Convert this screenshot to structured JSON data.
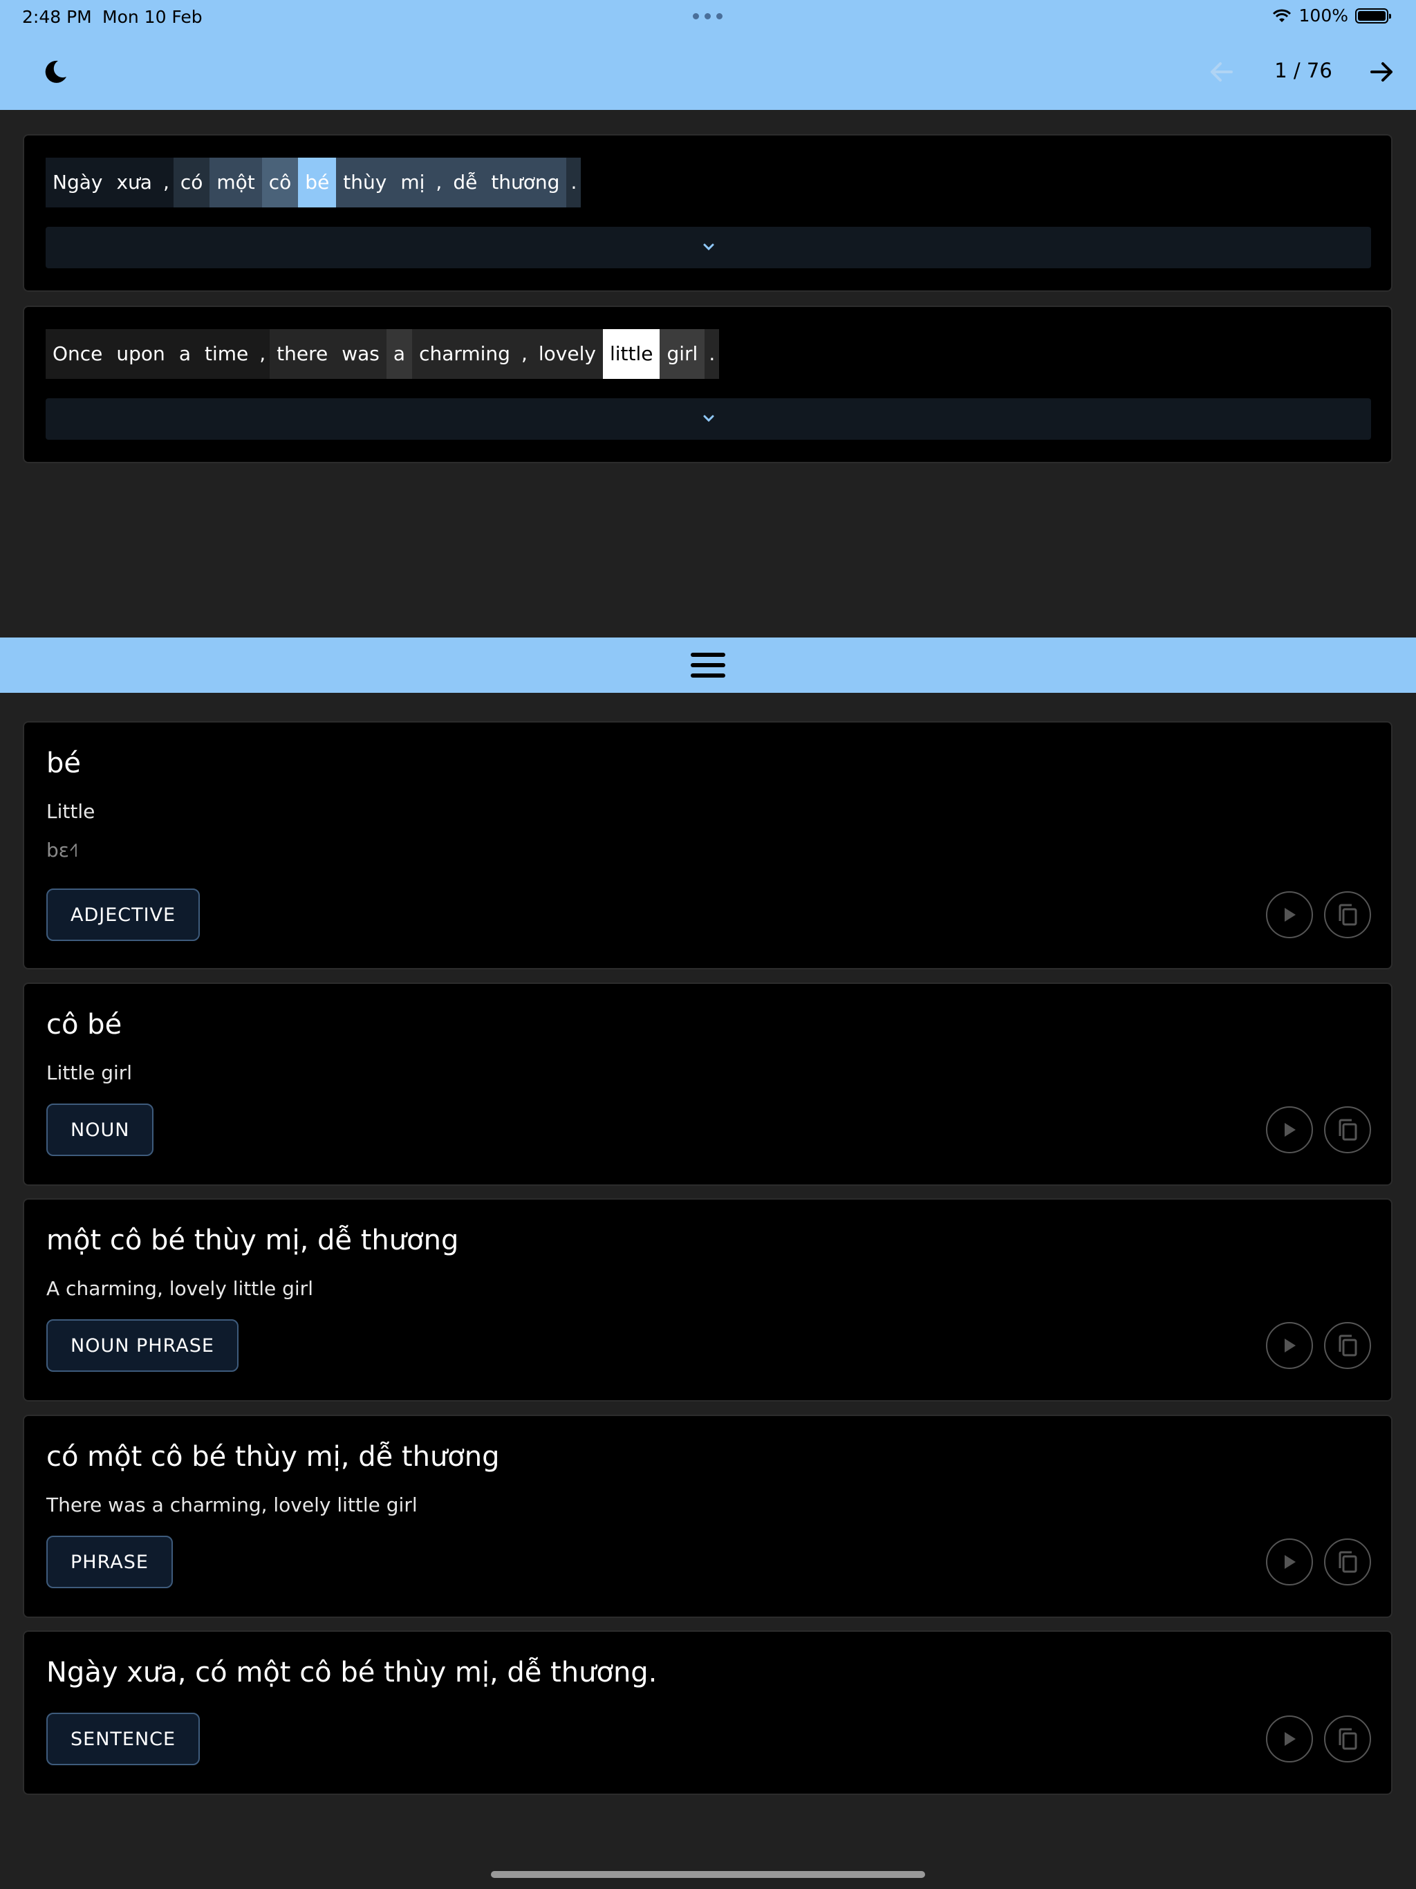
{
  "status_bar": {
    "time": "2:48 PM",
    "date": "Mon 10 Feb",
    "battery": "100%"
  },
  "header": {
    "page_indicator": "1 / 76",
    "icons": [
      "moon-icon",
      "arrow-left-icon",
      "arrow-right-icon"
    ]
  },
  "vietnamese_sentence": {
    "tokens": [
      {
        "text": "Ngày",
        "bg": "#111820",
        "color": "#ffffff"
      },
      {
        "text": "xưa",
        "bg": "#111820",
        "color": "#ffffff"
      },
      {
        "text": ",",
        "bg": "#111820",
        "color": "#ffffff"
      },
      {
        "text": "có",
        "bg": "#24303c",
        "color": "#ffffff"
      },
      {
        "text": "một",
        "bg": "#37495c",
        "color": "#ffffff"
      },
      {
        "text": "cô",
        "bg": "#4a6279",
        "color": "#ffffff"
      },
      {
        "text": "bé",
        "bg": "#90c8f8",
        "color": "#ffffff"
      },
      {
        "text": "thùy",
        "bg": "#37495c",
        "color": "#ffffff"
      },
      {
        "text": "mị",
        "bg": "#37495c",
        "color": "#ffffff"
      },
      {
        "text": ",",
        "bg": "#37495c",
        "color": "#ffffff"
      },
      {
        "text": "dễ",
        "bg": "#37495c",
        "color": "#ffffff"
      },
      {
        "text": "thương",
        "bg": "#37495c",
        "color": "#ffffff"
      },
      {
        "text": ".",
        "bg": "#24303c",
        "color": "#ffffff"
      }
    ]
  },
  "english_sentence": {
    "tokens": [
      {
        "text": "Once",
        "bg": "#1a1a1a",
        "color": "#ffffff"
      },
      {
        "text": "upon",
        "bg": "#1a1a1a",
        "color": "#ffffff"
      },
      {
        "text": "a",
        "bg": "#1a1a1a",
        "color": "#ffffff"
      },
      {
        "text": "time",
        "bg": "#1a1a1a",
        "color": "#ffffff"
      },
      {
        "text": ",",
        "bg": "#1a1a1a",
        "color": "#ffffff"
      },
      {
        "text": "there",
        "bg": "#262626",
        "color": "#ffffff"
      },
      {
        "text": "was",
        "bg": "#262626",
        "color": "#ffffff"
      },
      {
        "text": "a",
        "bg": "#363636",
        "color": "#ffffff"
      },
      {
        "text": "charming",
        "bg": "#262626",
        "color": "#ffffff"
      },
      {
        "text": ",",
        "bg": "#262626",
        "color": "#ffffff"
      },
      {
        "text": "lovely",
        "bg": "#262626",
        "color": "#ffffff"
      },
      {
        "text": "little",
        "bg": "#ffffff",
        "color": "#000000"
      },
      {
        "text": "girl",
        "bg": "#3c3c3c",
        "color": "#ffffff"
      },
      {
        "text": ".",
        "bg": "#262626",
        "color": "#ffffff"
      }
    ]
  },
  "cards": [
    {
      "title": "bé",
      "definition": "Little",
      "ipa": "bɛ˧˥",
      "tag": "ADJECTIVE"
    },
    {
      "title": "cô bé",
      "definition": "Little girl",
      "tag": "NOUN"
    },
    {
      "title": "một cô bé thùy mị, dễ thương",
      "definition": "A charming, lovely little girl",
      "tag": "NOUN PHRASE"
    },
    {
      "title": "có một cô bé thùy mị, dễ thương",
      "definition": "There was a charming, lovely little girl",
      "tag": "PHRASE"
    },
    {
      "title": "Ngày xưa, có một cô bé thùy mị, dễ thương.",
      "tag": "SENTENCE"
    }
  ],
  "colors": {
    "accent": "#90c8f8",
    "background": "#212121",
    "panel": "#000000",
    "tag_bg": "#0e1b2c"
  }
}
